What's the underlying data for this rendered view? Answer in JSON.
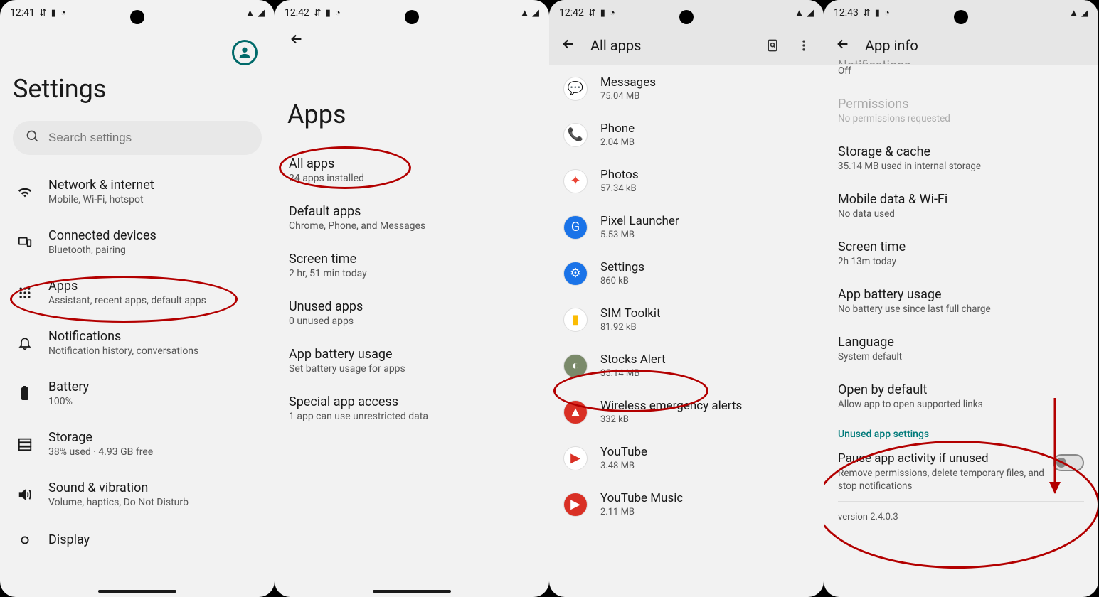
{
  "panel1": {
    "time": "12:41",
    "title": "Settings",
    "searchPlaceholder": "Search settings",
    "items": [
      {
        "title": "Network & internet",
        "sub": "Mobile, Wi-Fi, hotspot",
        "icon": "wifi"
      },
      {
        "title": "Connected devices",
        "sub": "Bluetooth, pairing",
        "icon": "devices"
      },
      {
        "title": "Apps",
        "sub": "Assistant, recent apps, default apps",
        "icon": "grid"
      },
      {
        "title": "Notifications",
        "sub": "Notification history, conversations",
        "icon": "bell"
      },
      {
        "title": "Battery",
        "sub": "100%",
        "icon": "battery"
      },
      {
        "title": "Storage",
        "sub": "38% used · 4.93 GB free",
        "icon": "storage"
      },
      {
        "title": "Sound & vibration",
        "sub": "Volume, haptics, Do Not Disturb",
        "icon": "sound"
      },
      {
        "title": "Display",
        "sub": "",
        "icon": "display"
      }
    ]
  },
  "panel2": {
    "time": "12:42",
    "title": "Apps",
    "items": [
      {
        "title": "All apps",
        "sub": "24 apps installed"
      },
      {
        "title": "Default apps",
        "sub": "Chrome, Phone, and Messages"
      },
      {
        "title": "Screen time",
        "sub": "2 hr, 51 min today"
      },
      {
        "title": "Unused apps",
        "sub": "0 unused apps"
      },
      {
        "title": "App battery usage",
        "sub": "Set battery usage for apps"
      },
      {
        "title": "Special app access",
        "sub": "1 app can use unrestricted data"
      }
    ]
  },
  "panel3": {
    "time": "12:42",
    "title": "All apps",
    "apps": [
      {
        "name": "Messages",
        "size": "75.04 MB",
        "bg": "#fff",
        "fg": "#1a73e8",
        "glyph": "💬"
      },
      {
        "name": "Phone",
        "size": "2.04 MB",
        "bg": "#fff",
        "fg": "#1a73e8",
        "glyph": "📞"
      },
      {
        "name": "Photos",
        "size": "57.34 kB",
        "bg": "#fff",
        "fg": "#ea4335",
        "glyph": "✦"
      },
      {
        "name": "Pixel Launcher",
        "size": "5.53 MB",
        "bg": "#1a73e8",
        "fg": "#fff",
        "glyph": "G"
      },
      {
        "name": "Settings",
        "size": "860 kB",
        "bg": "#1a73e8",
        "fg": "#fff",
        "glyph": "⚙"
      },
      {
        "name": "SIM Toolkit",
        "size": "81.92 kB",
        "bg": "#fff",
        "fg": "#fbbc04",
        "glyph": "▮"
      },
      {
        "name": "Stocks Alert",
        "size": "35.14 MB",
        "bg": "#7a8a6a",
        "fg": "#fff",
        "glyph": "◐"
      },
      {
        "name": "Wireless emergency alerts",
        "size": "332 kB",
        "bg": "#d93025",
        "fg": "#fff",
        "glyph": "▲"
      },
      {
        "name": "YouTube",
        "size": "3.48 MB",
        "bg": "#fff",
        "fg": "#d93025",
        "glyph": "▶"
      },
      {
        "name": "YouTube Music",
        "size": "2.11 MB",
        "bg": "#d93025",
        "fg": "#fff",
        "glyph": "▶"
      }
    ]
  },
  "panel4": {
    "time": "12:43",
    "title": "App info",
    "notifTitle": "Notifications",
    "notifSub": "Off",
    "permTitle": "Permissions",
    "permSub": "No permissions requested",
    "rows": [
      {
        "title": "Storage & cache",
        "sub": "35.14 MB used in internal storage"
      },
      {
        "title": "Mobile data & Wi-Fi",
        "sub": "No data used"
      },
      {
        "title": "Screen time",
        "sub": "2h 13m today"
      },
      {
        "title": "App battery usage",
        "sub": "No battery use since last full charge"
      },
      {
        "title": "Language",
        "sub": "System default"
      },
      {
        "title": "Open by default",
        "sub": "Allow app to open supported links"
      }
    ],
    "sectionLabel": "Unused app settings",
    "toggleTitle": "Pause app activity if unused",
    "toggleSub": "Remove permissions, delete temporary files, and stop notifications",
    "version": "version 2.4.0.3"
  }
}
